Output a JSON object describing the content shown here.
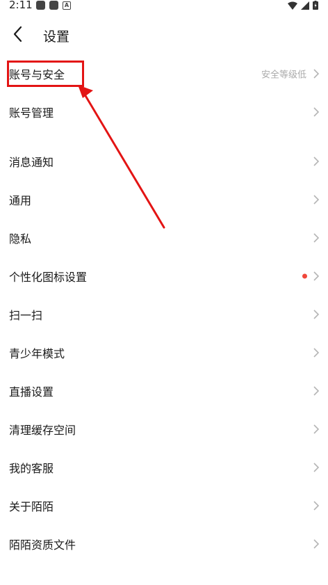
{
  "status": {
    "time": "2:11"
  },
  "header": {
    "title": "设置"
  },
  "items": [
    {
      "label": "账号与安全",
      "hint": "安全等级低"
    },
    {
      "label": "账号管理"
    },
    {
      "label": "消息通知"
    },
    {
      "label": "通用"
    },
    {
      "label": "隐私"
    },
    {
      "label": "个性化图标设置",
      "badge": "red-dot"
    },
    {
      "label": "扫一扫"
    },
    {
      "label": "青少年模式"
    },
    {
      "label": "直播设置"
    },
    {
      "label": "清理缓存空间"
    },
    {
      "label": "我的客服"
    },
    {
      "label": "关于陌陌"
    },
    {
      "label": "陌陌资质文件"
    }
  ],
  "colors": {
    "accent_red": "#e31414",
    "badge_dot": "#f0473a",
    "hint_text": "#aaaaaa"
  }
}
